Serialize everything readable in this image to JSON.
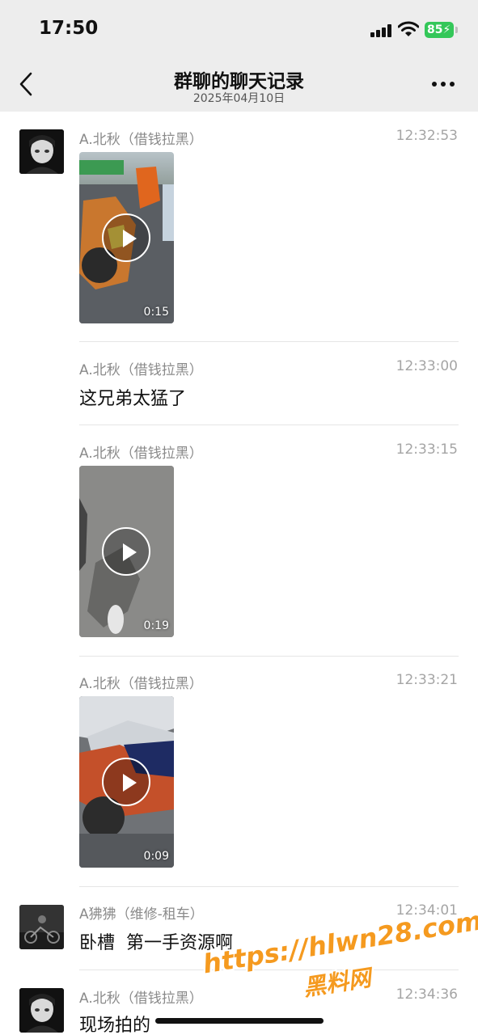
{
  "status_bar": {
    "time": "17:50",
    "battery": "85"
  },
  "header": {
    "title": "群聊的聊天记录",
    "date": "2025年04月10日"
  },
  "messages": [
    {
      "sender": "A.北秋（借钱拉黑）",
      "time": "12:32:53",
      "type": "video",
      "duration": "0:15"
    },
    {
      "sender": "A.北秋（借钱拉黑）",
      "time": "12:33:00",
      "type": "text",
      "text": "这兄弟太猛了"
    },
    {
      "sender": "A.北秋（借钱拉黑）",
      "time": "12:33:15",
      "type": "video",
      "duration": "0:19"
    },
    {
      "sender": "A.北秋（借钱拉黑）",
      "time": "12:33:21",
      "type": "video",
      "duration": "0:09"
    },
    {
      "sender": "A狒狒（维修-租车）",
      "time": "12:34:01",
      "type": "text",
      "text": "卧槽  第一手资源啊"
    },
    {
      "sender": "A.北秋（借钱拉黑）",
      "time": "12:34:36",
      "type": "text",
      "text": "现场拍的"
    }
  ],
  "watermark": {
    "url": "https://hlwn28.com",
    "name": "黑料网"
  },
  "colors": {
    "header_bg": "#ededed",
    "battery_green": "#34c759",
    "watermark_orange": "#f59a1f"
  }
}
